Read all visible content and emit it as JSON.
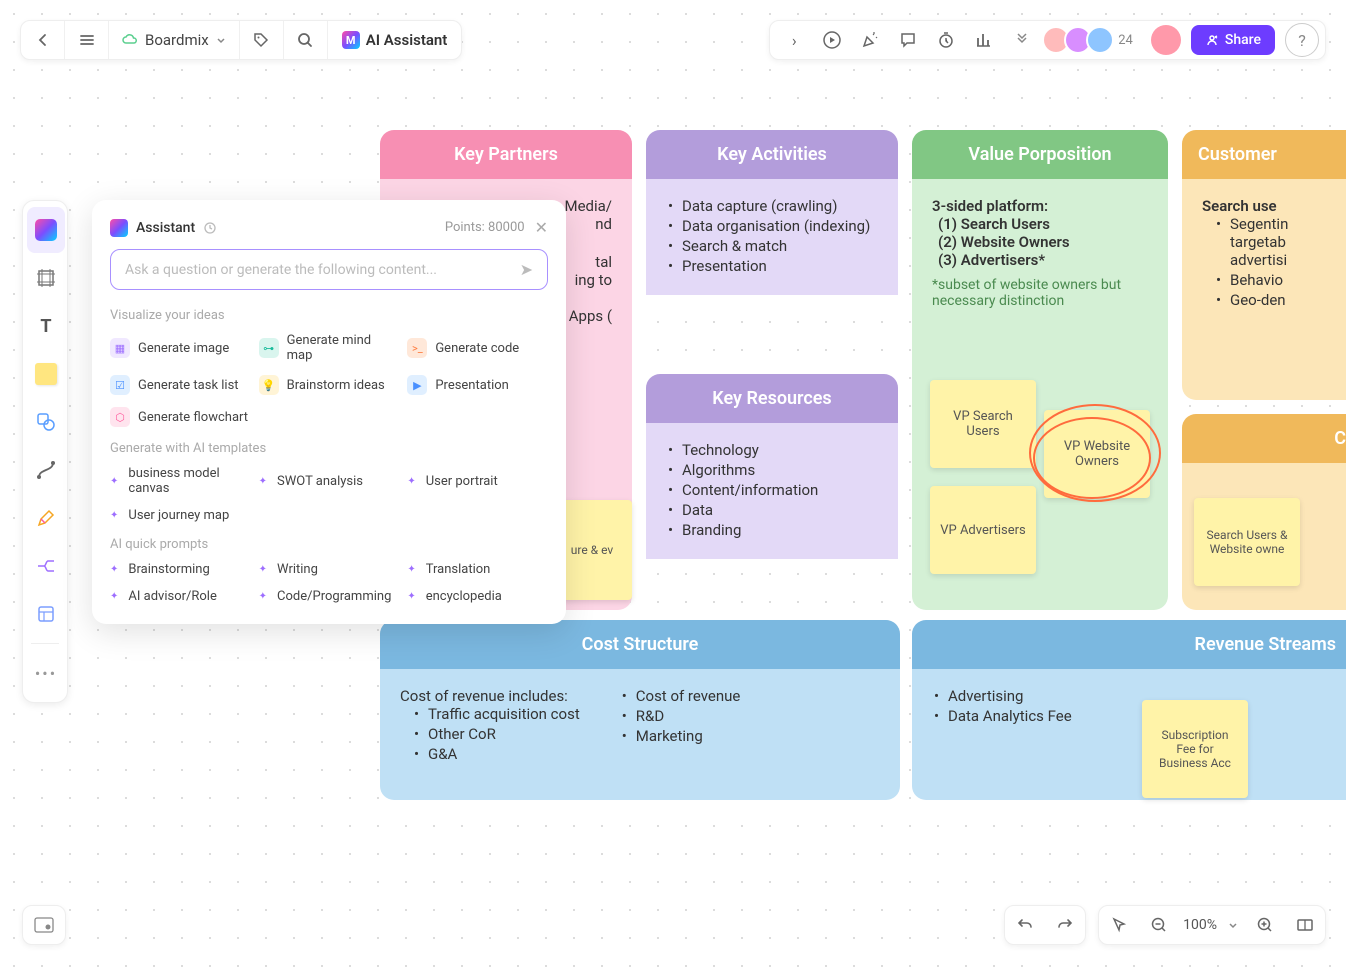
{
  "header": {
    "app_name": "Boardmix",
    "ai_label": "AI Assistant",
    "share_label": "Share",
    "avatar_count": "24"
  },
  "assistant": {
    "title": "Assistant",
    "points_label": "Points: 80000",
    "placeholder": "Ask a question or generate the following content...",
    "section_visualize": "Visualize your ideas",
    "items_visualize": {
      "gen_image": "Generate image",
      "gen_mindmap": "Generate mind map",
      "gen_code": "Generate code",
      "gen_tasklist": "Generate task list",
      "brainstorm": "Brainstorm ideas",
      "presentation": "Presentation",
      "gen_flowchart": "Generate flowchart"
    },
    "section_templates": "Generate with AI templates",
    "items_templates": {
      "bmc": "business model canvas",
      "swot": "SWOT analysis",
      "user_portrait": "User portrait",
      "user_journey": "User journey map"
    },
    "section_prompts": "AI quick prompts",
    "items_prompts": {
      "brainstorming": "Brainstorming",
      "writing": "Writing",
      "translation": "Translation",
      "ai_advisor": "AI advisor/Role",
      "code": "Code/Programming",
      "encyclopedia": "encyclopedia"
    }
  },
  "canvas": {
    "key_partners": {
      "title": "Key Partners",
      "items": [
        "Media/",
        "nd",
        "tal",
        "ing to",
        "Apps ("
      ]
    },
    "key_activities": {
      "title": "Key Activities",
      "items": [
        "Data capture (crawling)",
        "Data organisation (indexing)",
        "Search & match",
        "Presentation"
      ]
    },
    "key_resources": {
      "title": "Key Resources",
      "items": [
        "Technology",
        "Algorithms",
        "Content/information",
        "Data",
        "Branding"
      ]
    },
    "value_prop": {
      "title": "Value Porposition",
      "heading": "3-sided platform:",
      "items": [
        "(1) Search Users",
        "(2) Website Owners",
        "(3) Advertisers*"
      ],
      "note": "*subset of website owners but necessary distinction"
    },
    "customer": {
      "title": "Customer",
      "heading": "Search use",
      "items": [
        "Segentin",
        "targetab",
        "advertisi",
        "Behavio",
        "Geo-den"
      ]
    },
    "cost": {
      "title": "Cost Structure",
      "heading": "Cost of revenue includes:",
      "items1": [
        "Traffic acquisition cost",
        "Other CoR",
        "G&A"
      ],
      "items2": [
        "Cost of revenue",
        "R&D",
        "Marketing"
      ]
    },
    "revenue": {
      "title": "Revenue Streams",
      "items": [
        "Advertising",
        "Data Analytics Fee"
      ]
    },
    "stickies": {
      "vp_search": "VP Search Users",
      "vp_website": "VP Website Owners",
      "vp_adv": "VP Advertisers",
      "search_users": "Search Users & Website owne",
      "sub_fee": "Subscription Fee for Business Acc",
      "partial_sticky": "ure & ev",
      "cust_partial": "C"
    }
  },
  "zoom": "100%"
}
